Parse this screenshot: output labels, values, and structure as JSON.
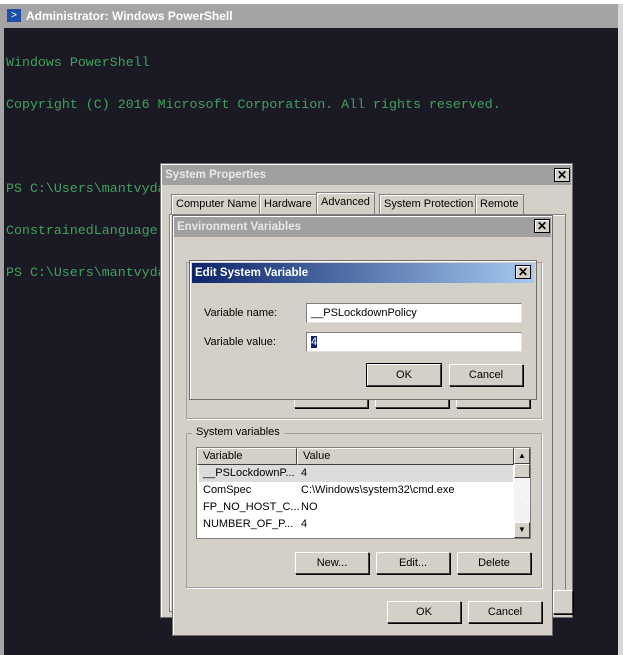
{
  "powershell": {
    "title": "Administrator: Windows PowerShell",
    "icon": "powershell-icon",
    "lines": [
      "Windows PowerShell",
      "Copyright (C) 2016 Microsoft Corporation. All rights reserved.",
      "",
      "PS C:\\Users\\mantvydas> $ExecutionContext.SessionState.LanguageMode",
      "ConstrainedLanguage",
      "PS C:\\Users\\mantvydas>"
    ]
  },
  "system_properties": {
    "title": "System Properties",
    "tabs": [
      {
        "label": "Computer Name"
      },
      {
        "label": "Hardware"
      },
      {
        "label": "Advanced",
        "active": true
      },
      {
        "label": "System Protection"
      },
      {
        "label": "Remote"
      }
    ]
  },
  "environment_variables": {
    "title": "Environment Variables",
    "system_group_label": "System variables",
    "columns": [
      "Variable",
      "Value"
    ],
    "rows": [
      {
        "variable": "__PSLockdownP...",
        "value": "4",
        "selected": true
      },
      {
        "variable": "ComSpec",
        "value": "C:\\Windows\\system32\\cmd.exe"
      },
      {
        "variable": "FP_NO_HOST_C...",
        "value": "NO"
      },
      {
        "variable": "NUMBER_OF_P...",
        "value": "4"
      }
    ],
    "new_label": "New...",
    "edit_label": "Edit...",
    "delete_label": "Delete",
    "ok_label": "OK",
    "cancel_label": "Cancel"
  },
  "edit_dialog": {
    "title": "Edit System Variable",
    "name_label": "Variable name:",
    "name_value": "__PSLockdownPolicy",
    "value_label": "Variable value:",
    "value_value": "4",
    "ok_label": "OK",
    "cancel_label": "Cancel"
  },
  "close_glyph": "✕",
  "colors": {
    "console_text": "#3da35d",
    "console_bg": "#1b1923",
    "dialog_bg": "#d4d0c8",
    "active_title_start": "#0a246a",
    "active_title_end": "#a6caf0"
  }
}
